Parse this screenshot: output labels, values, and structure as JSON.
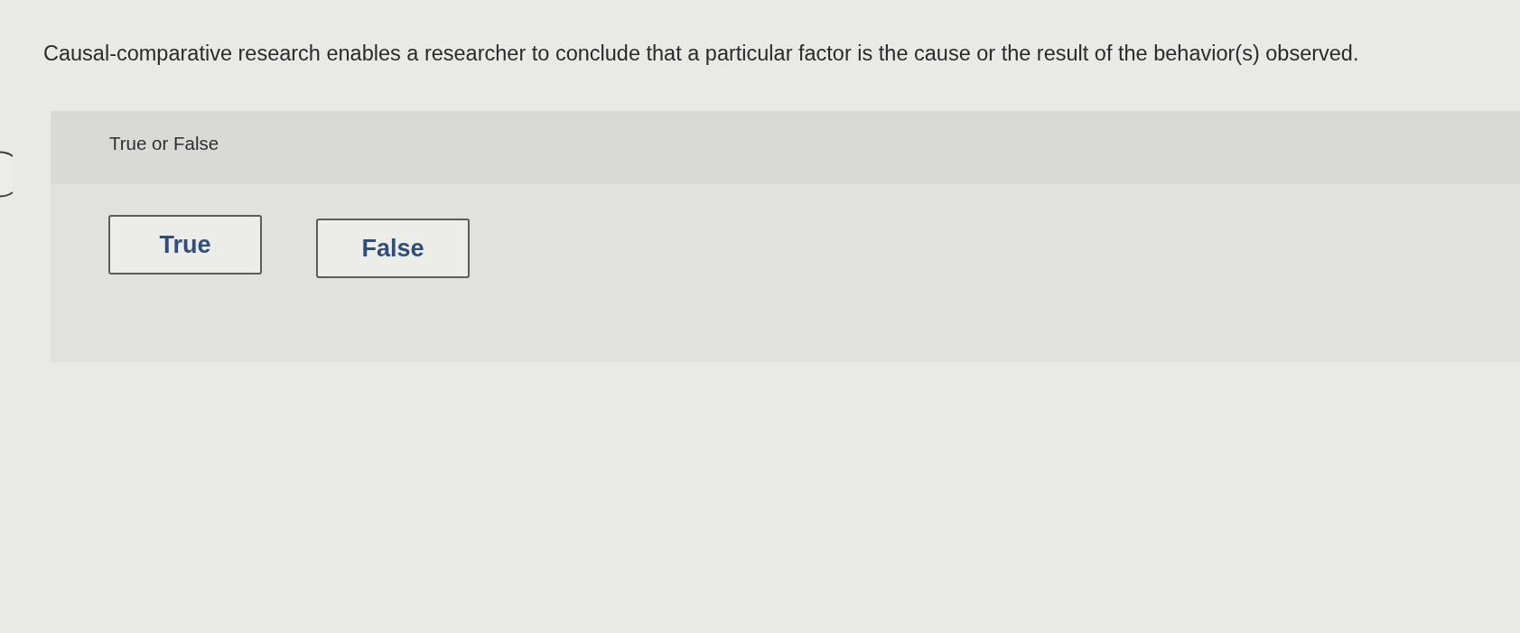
{
  "question": {
    "text": "Causal-comparative research enables a researcher to conclude that a particular factor is the cause or the result of the behavior(s) observed."
  },
  "answer_panel": {
    "label": "True or False",
    "choices": [
      {
        "label": "True",
        "selected": false
      },
      {
        "label": "False",
        "selected": false
      }
    ]
  }
}
